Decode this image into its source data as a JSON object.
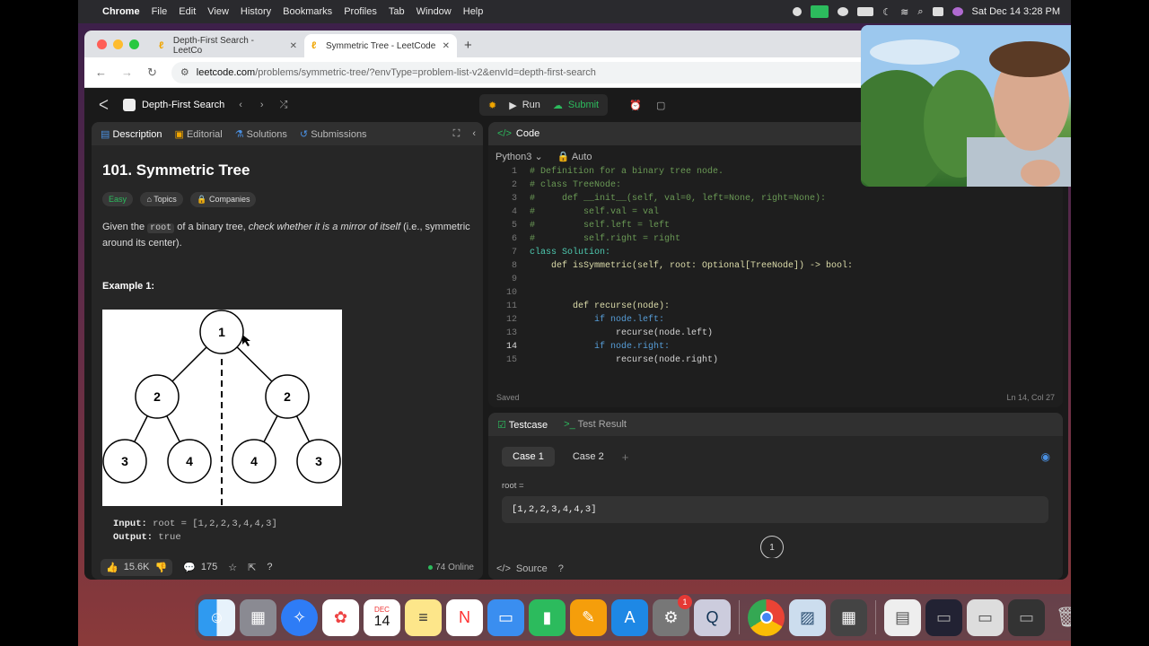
{
  "menubar": {
    "items": [
      "Chrome",
      "File",
      "Edit",
      "View",
      "History",
      "Bookmarks",
      "Profiles",
      "Tab",
      "Window",
      "Help"
    ],
    "datetime": "Sat Dec 14  3:28 PM"
  },
  "browser": {
    "tabs": [
      {
        "title": "Depth-First Search - LeetCo"
      },
      {
        "title": "Symmetric Tree - LeetCode"
      }
    ],
    "url_domain": "leetcode.com",
    "url_path": "/problems/symmetric-tree/?envType=problem-list-v2&envId=depth-first-search"
  },
  "lc": {
    "problem_list": "Depth-First Search",
    "run_label": "Run",
    "submit_label": "Submit",
    "left_tabs": [
      "Description",
      "Editorial",
      "Solutions",
      "Submissions"
    ],
    "title": "101. Symmetric Tree",
    "difficulty": "Easy",
    "topics_label": "Topics",
    "companies_label": "Companies",
    "desc_a": "Given the ",
    "desc_code": "root",
    "desc_b": " of a binary tree, ",
    "desc_em": "check whether it is a mirror of itself",
    "desc_c": " (i.e., symmetric around its center).",
    "example_title": "Example 1:",
    "tree_nodes": [
      "1",
      "2",
      "2",
      "3",
      "4",
      "4",
      "3"
    ],
    "input_label": "Input:",
    "input_value": "root = [1,2,2,3,4,4,3]",
    "output_label": "Output:",
    "output_value": "true",
    "likes": "15.6K",
    "comments": "175",
    "online": "74 Online"
  },
  "code": {
    "header": "Code",
    "language": "Python3",
    "mode": "Auto",
    "lines": [
      {
        "n": "1",
        "t": "# Definition for a binary tree node.",
        "c": "cm"
      },
      {
        "n": "2",
        "t": "# class TreeNode:",
        "c": "cm"
      },
      {
        "n": "3",
        "t": "#     def __init__(self, val=0, left=None, right=None):",
        "c": "cm"
      },
      {
        "n": "4",
        "t": "#         self.val = val",
        "c": "cm"
      },
      {
        "n": "5",
        "t": "#         self.left = left",
        "c": "cm"
      },
      {
        "n": "6",
        "t": "#         self.right = right",
        "c": "cm"
      },
      {
        "n": "7",
        "t": "class Solution:",
        "c": "cls"
      },
      {
        "n": "8",
        "t": "    def isSymmetric(self, root: Optional[TreeNode]) -> bool:",
        "c": "fn"
      },
      {
        "n": "9",
        "t": "",
        "c": ""
      },
      {
        "n": "10",
        "t": "",
        "c": ""
      },
      {
        "n": "11",
        "t": "        def recurse(node):",
        "c": "fn"
      },
      {
        "n": "12",
        "t": "            if node.left:",
        "c": "kw"
      },
      {
        "n": "13",
        "t": "                recurse(node.left)",
        "c": ""
      },
      {
        "n": "14",
        "t": "            if node.right:",
        "c": "kw"
      },
      {
        "n": "15",
        "t": "                recurse(node.right)",
        "c": ""
      }
    ],
    "saved": "Saved",
    "cursor_pos": "Ln 14, Col 27"
  },
  "testcase": {
    "tab_testcase": "Testcase",
    "tab_result": "Test Result",
    "cases": [
      "Case 1",
      "Case 2"
    ],
    "add_case": "+",
    "root_label": "root =",
    "root_value": "[1,2,2,3,4,4,3]",
    "preview_node": "1",
    "source_label": "Source"
  },
  "dock": {
    "calendar_month": "DEC",
    "calendar_day": "14",
    "settings_badge": "1"
  }
}
